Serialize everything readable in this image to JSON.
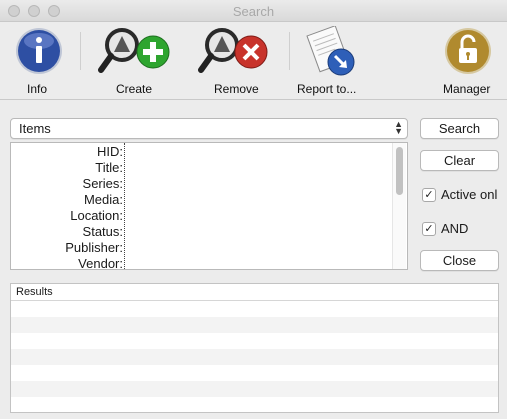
{
  "window": {
    "title": "Search"
  },
  "toolbar": {
    "items": [
      {
        "label": "Info"
      },
      {
        "label": "Create"
      },
      {
        "label": "Remove"
      },
      {
        "label": "Report to..."
      },
      {
        "label": "Manager"
      }
    ]
  },
  "search_type": {
    "selected": "Items"
  },
  "fields": {
    "labels": [
      "HID:",
      "Title:",
      "Series:",
      "Media:",
      "Location:",
      "Status:",
      "Publisher:",
      "Vendor:"
    ]
  },
  "buttons": {
    "search": "Search",
    "clear": "Clear",
    "close": "Close"
  },
  "options": {
    "active_only": {
      "label": "Active onl",
      "checked": true
    },
    "and": {
      "label": "AND",
      "checked": true
    }
  },
  "results": {
    "header": "Results"
  },
  "colors": {
    "info_blue": "#2e4fa3",
    "create_green": "#2ea52f",
    "remove_red": "#c8332b",
    "manager_gold": "#b08a2e"
  }
}
